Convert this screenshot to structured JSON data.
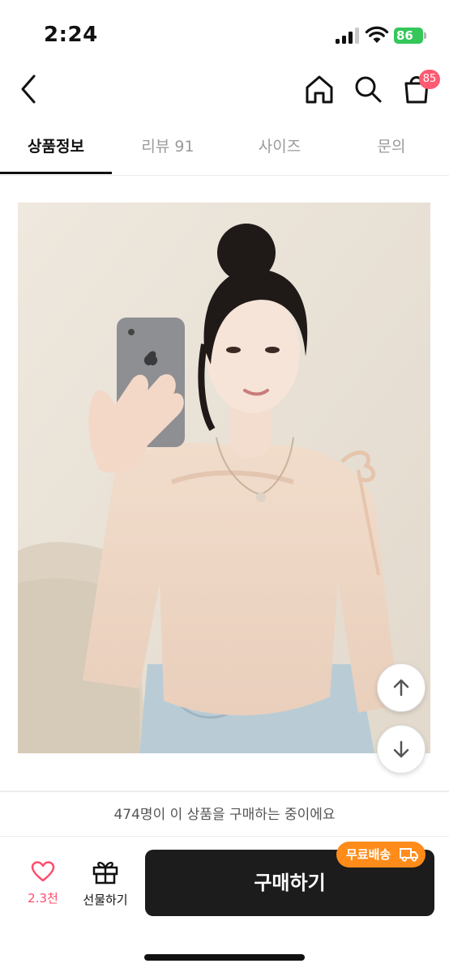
{
  "status_bar": {
    "time": "2:24",
    "battery": "86"
  },
  "header": {
    "cart_count": "85"
  },
  "tabs": [
    {
      "label": "상품정보",
      "active": true
    },
    {
      "label": "리뷰 91",
      "active": false
    },
    {
      "label": "사이즈",
      "active": false
    },
    {
      "label": "문의",
      "active": false
    }
  ],
  "buyers_text": "474명이 이 상품을 구매하는 중이에요",
  "like": {
    "count": "2.3천"
  },
  "gift": {
    "label": "선물하기"
  },
  "buy": {
    "label": "구매하기",
    "badge": "무료배송"
  },
  "colors": {
    "accent_pink": "#ff4d6d",
    "buy_button": "#1c1c1c",
    "free_shipping": "#ff8c1a",
    "battery": "#34c759"
  }
}
